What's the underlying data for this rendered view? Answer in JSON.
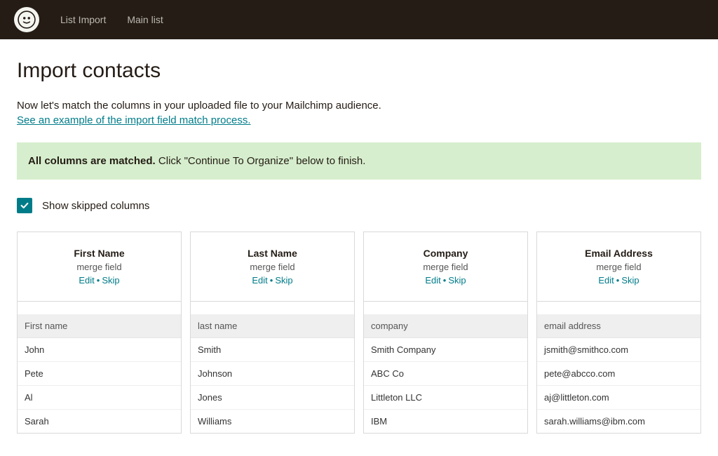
{
  "nav": {
    "item1": "List Import",
    "item2": "Main list"
  },
  "page": {
    "title": "Import contacts",
    "instruction": "Now let's match the columns in your uploaded file to your Mailchimp audience.",
    "example_link": "See an example of the import field match process."
  },
  "banner": {
    "bold": "All columns are matched.",
    "rest": " Click \"Continue To Organize\" below to finish."
  },
  "skip_checkbox_label": "Show skipped columns",
  "common": {
    "merge_field": "merge field",
    "edit": "Edit",
    "skip": "Skip"
  },
  "columns": [
    {
      "title": "First Name",
      "source_header": "First name",
      "rows": [
        "John",
        "Pete",
        "Al",
        "Sarah"
      ]
    },
    {
      "title": "Last Name",
      "source_header": "last name",
      "rows": [
        "Smith",
        "Johnson",
        "Jones",
        "Williams"
      ]
    },
    {
      "title": "Company",
      "source_header": "company",
      "rows": [
        "Smith Company",
        "ABC Co",
        "Littleton LLC",
        "IBM"
      ]
    },
    {
      "title": "Email Address",
      "source_header": "email address",
      "rows": [
        "jsmith@smithco.com",
        "pete@abcco.com",
        "aj@littleton.com",
        "sarah.williams@ibm.com"
      ]
    }
  ]
}
